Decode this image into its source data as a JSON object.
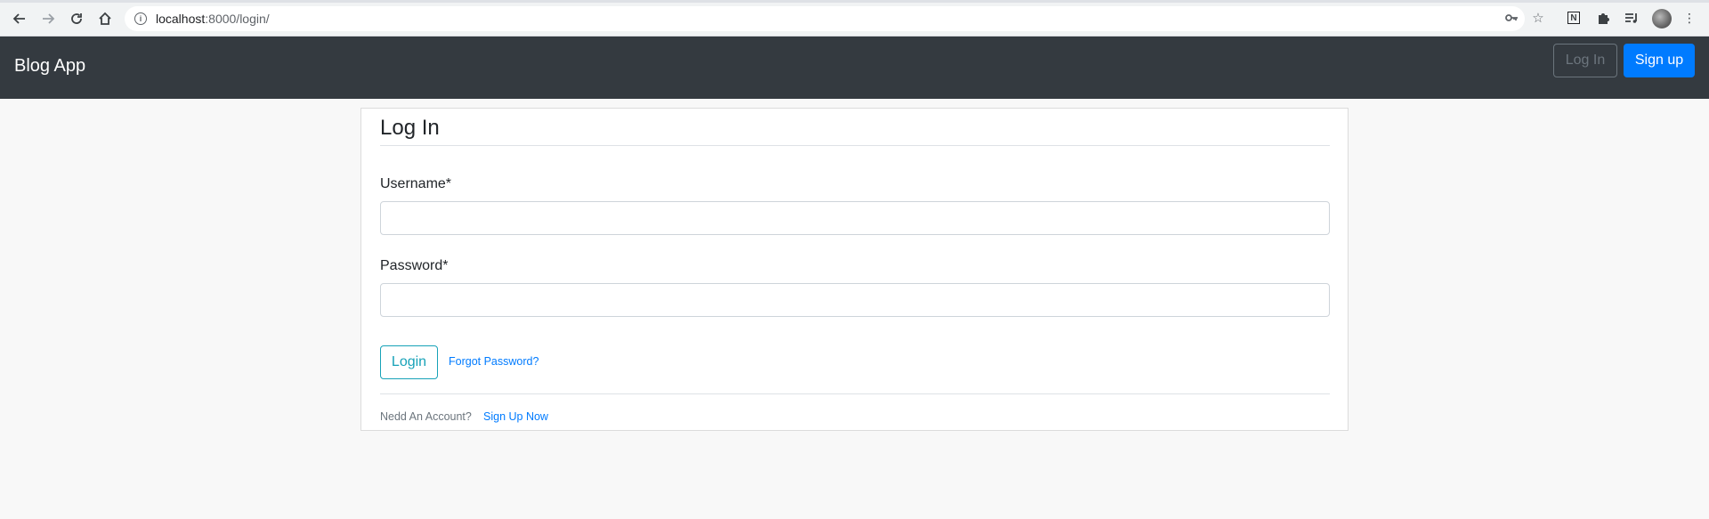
{
  "browser": {
    "url_host": "localhost",
    "url_rest": ":8000/login/"
  },
  "navbar": {
    "brand": "Blog App",
    "login_label": "Log In",
    "signup_label": "Sign up"
  },
  "form": {
    "title": "Log In",
    "username_label": "Username*",
    "username_value": "",
    "password_label": "Password*",
    "password_value": "",
    "submit_label": "Login",
    "forgot_label": "Forgot Password?",
    "need_account": "Nedd An Account?",
    "signup_link": "Sign Up Now"
  },
  "colors": {
    "navbar_bg": "#343a40",
    "primary": "#007bff",
    "info": "#17a2b8",
    "secondary": "#6c757d"
  }
}
